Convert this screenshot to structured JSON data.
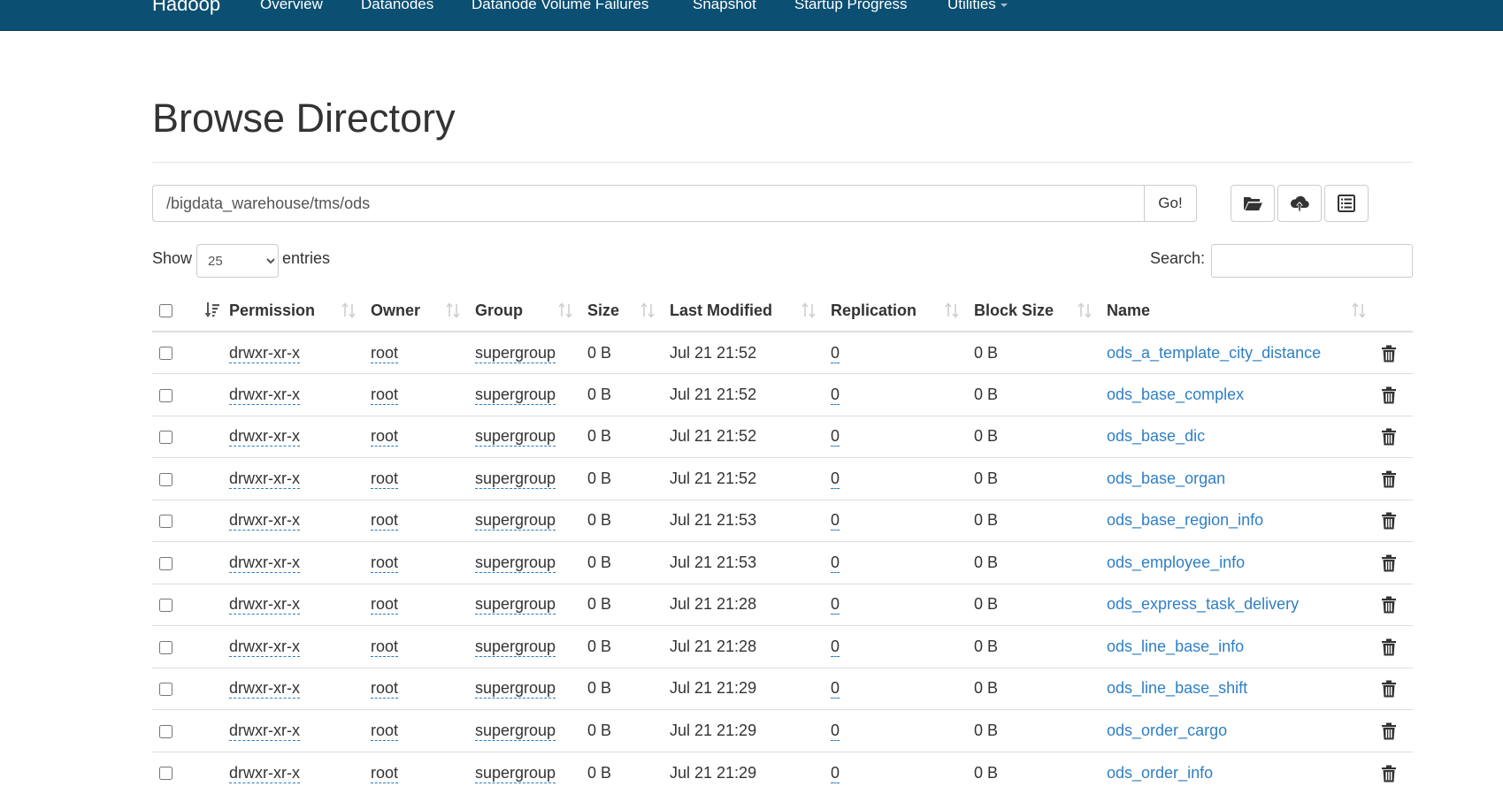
{
  "navbar": {
    "brand": "Hadoop",
    "items": [
      "Overview",
      "Datanodes",
      "Datanode Volume Failures",
      "Snapshot",
      "Startup Progress",
      "Utilities"
    ]
  },
  "page_title": "Browse Directory",
  "path": {
    "value": "/bigdata_warehouse/tms/ods",
    "go_label": "Go!"
  },
  "toolbar": {
    "icons": [
      "folder-open-icon",
      "cloud-upload-icon",
      "list-icon"
    ]
  },
  "length_menu": {
    "show_label": "Show",
    "selected": "25",
    "options": [
      "25"
    ],
    "entries_label": "entries"
  },
  "search": {
    "label": "Search:",
    "value": ""
  },
  "table": {
    "columns": [
      "Permission",
      "Owner",
      "Group",
      "Size",
      "Last Modified",
      "Replication",
      "Block Size",
      "Name"
    ],
    "rows": [
      {
        "permission": "drwxr-xr-x",
        "owner": "root",
        "group": "supergroup",
        "size": "0 B",
        "modified": "Jul 21 21:52",
        "replication": "0",
        "block_size": "0 B",
        "name": "ods_a_template_city_distance"
      },
      {
        "permission": "drwxr-xr-x",
        "owner": "root",
        "group": "supergroup",
        "size": "0 B",
        "modified": "Jul 21 21:52",
        "replication": "0",
        "block_size": "0 B",
        "name": "ods_base_complex"
      },
      {
        "permission": "drwxr-xr-x",
        "owner": "root",
        "group": "supergroup",
        "size": "0 B",
        "modified": "Jul 21 21:52",
        "replication": "0",
        "block_size": "0 B",
        "name": "ods_base_dic"
      },
      {
        "permission": "drwxr-xr-x",
        "owner": "root",
        "group": "supergroup",
        "size": "0 B",
        "modified": "Jul 21 21:52",
        "replication": "0",
        "block_size": "0 B",
        "name": "ods_base_organ"
      },
      {
        "permission": "drwxr-xr-x",
        "owner": "root",
        "group": "supergroup",
        "size": "0 B",
        "modified": "Jul 21 21:53",
        "replication": "0",
        "block_size": "0 B",
        "name": "ods_base_region_info"
      },
      {
        "permission": "drwxr-xr-x",
        "owner": "root",
        "group": "supergroup",
        "size": "0 B",
        "modified": "Jul 21 21:53",
        "replication": "0",
        "block_size": "0 B",
        "name": "ods_employee_info"
      },
      {
        "permission": "drwxr-xr-x",
        "owner": "root",
        "group": "supergroup",
        "size": "0 B",
        "modified": "Jul 21 21:28",
        "replication": "0",
        "block_size": "0 B",
        "name": "ods_express_task_delivery"
      },
      {
        "permission": "drwxr-xr-x",
        "owner": "root",
        "group": "supergroup",
        "size": "0 B",
        "modified": "Jul 21 21:28",
        "replication": "0",
        "block_size": "0 B",
        "name": "ods_line_base_info"
      },
      {
        "permission": "drwxr-xr-x",
        "owner": "root",
        "group": "supergroup",
        "size": "0 B",
        "modified": "Jul 21 21:29",
        "replication": "0",
        "block_size": "0 B",
        "name": "ods_line_base_shift"
      },
      {
        "permission": "drwxr-xr-x",
        "owner": "root",
        "group": "supergroup",
        "size": "0 B",
        "modified": "Jul 21 21:29",
        "replication": "0",
        "block_size": "0 B",
        "name": "ods_order_cargo"
      },
      {
        "permission": "drwxr-xr-x",
        "owner": "root",
        "group": "supergroup",
        "size": "0 B",
        "modified": "Jul 21 21:29",
        "replication": "0",
        "block_size": "0 B",
        "name": "ods_order_info"
      }
    ]
  },
  "colors": {
    "navbar": "#0b4f72",
    "link": "#2f7fc4",
    "editable_underline": "#2a7ac0",
    "border": "#dddddd"
  }
}
